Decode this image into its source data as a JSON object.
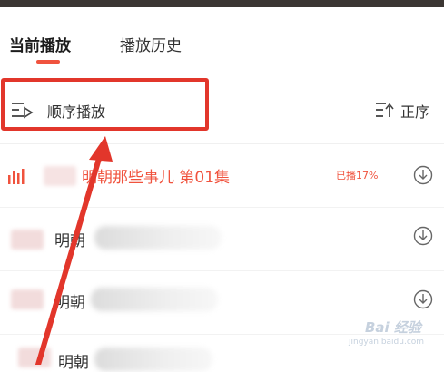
{
  "tabs": {
    "current": "当前播放",
    "history": "播放历史"
  },
  "mode": {
    "label": "顺序播放",
    "sort_label": "正序"
  },
  "episodes": [
    {
      "title": "明朝那些事儿 第01集",
      "title_prefix": "明",
      "progress": "已播17%"
    },
    {
      "title_visible": "明朝"
    },
    {
      "title_visible": "明朝"
    },
    {
      "title_visible": "明朝"
    }
  ],
  "colors": {
    "accent": "#f0533e",
    "highlight": "#e2362b"
  },
  "watermark": {
    "brand": "Bai 经验",
    "url": "jingyan.baidu.com"
  },
  "icons": {
    "mode": "sequential-play-icon",
    "sort": "sort-ascending-icon",
    "playing": "playing-bars-icon",
    "download": "download-icon"
  }
}
